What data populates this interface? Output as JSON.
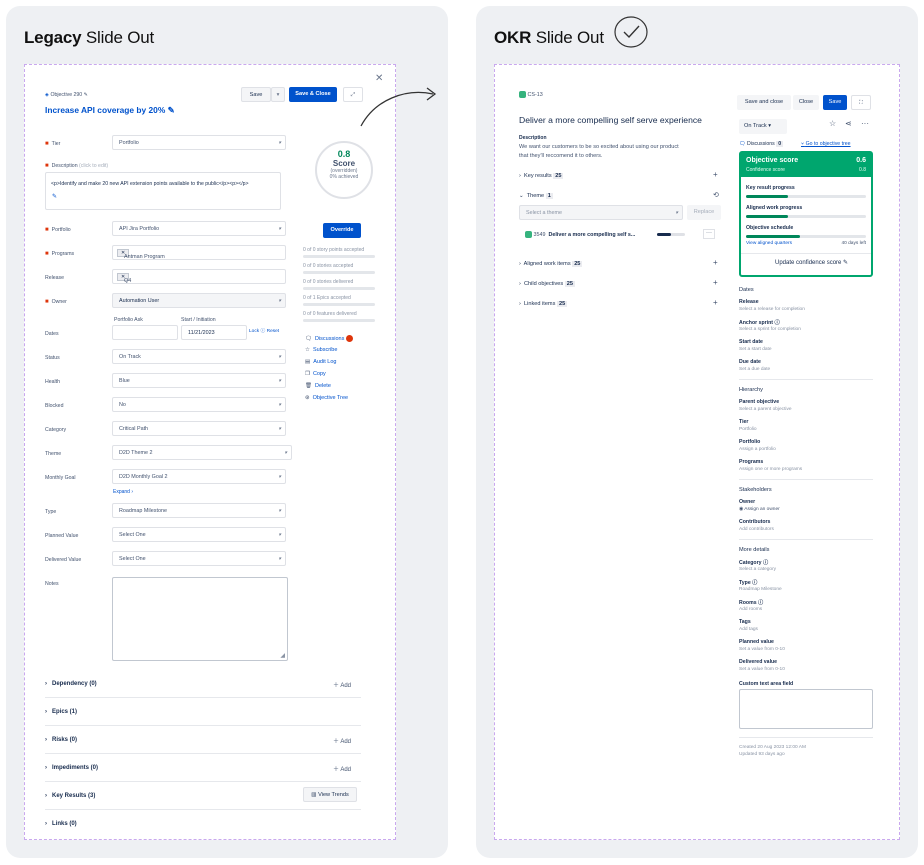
{
  "legacy": {
    "title_bold": "Legacy",
    "title_rest": " Slide Out",
    "objective_id": "Objective 290",
    "objective_title": "Increase API coverage by 20%",
    "save_label": "Save",
    "save_close_label": "Save & Close",
    "score_value": "0.8",
    "score_label": "Score",
    "score_note": "(overridden)",
    "score_achieved": "0% achieved",
    "override_label": "Override",
    "fields": {
      "tier_label": "Tier",
      "tier_value": "Portfolio",
      "description_label": "Description",
      "description_hint": "(click to edit)",
      "description_value": "<p>Identify and make 20 new API extension points available to the public</p><p></p>",
      "portfolio_label": "Portfolio",
      "portfolio_value": "API Jira Portfolio",
      "programs_label": "Programs",
      "programs_tag": "Antman Program",
      "release_label": "Release",
      "release_tag": "Q4",
      "owner_label": "Owner",
      "owner_value": "Automation User",
      "dates_label": "Dates",
      "portfolio_ask_label": "Portfolio Ask",
      "start_label": "Start / Initiation",
      "start_value": "11/21/2023",
      "lock_label": "Lock",
      "reset_label": "Reset",
      "status_label": "Status",
      "status_value": "On Track",
      "health_label": "Health",
      "health_value": "Blue",
      "blocked_label": "Blocked",
      "blocked_value": "No",
      "category_label": "Category",
      "category_value": "Critical Path",
      "theme_label": "Theme",
      "theme_value": "D2D Theme 2",
      "goal_label": "Monthly Goal",
      "goal_value": "D2D Monthly Goal 2",
      "expand_label": "Expand",
      "type_label": "Type",
      "type_value": "Roadmap Milestone",
      "planned_label": "Planned Value",
      "planned_value": "Select One",
      "delivered_label": "Delivered Value",
      "delivered_value": "Select One",
      "notes_label": "Notes"
    },
    "progress": [
      "0 of 0 story points accepted",
      "0 of 0 stories accepted",
      "0 of 0 stories delivered",
      "0 of 1 Epics accepted",
      "0 of 0 features delivered"
    ],
    "actions": {
      "discussions": "Discussions",
      "subscribe": "Subscribe",
      "audit": "Audit Log",
      "copy": "Copy",
      "delete": "Delete",
      "tree": "Objective Tree"
    },
    "sections": {
      "dependency": "Dependency (0)",
      "epics": "Epics (1)",
      "risks": "Risks (0)",
      "impediments": "Impediments (0)",
      "key_results": "Key Results (3)",
      "links": "Links (0)",
      "add": "Add",
      "view_trends": "View Trends"
    }
  },
  "okr": {
    "title_bold": "OKR",
    "title_rest": " Slide Out",
    "id": "CS-13",
    "title": "Deliver a more compelling self serve experience",
    "description_label": "Description",
    "description_text_1": "We want our customers to be so excited about using our product",
    "description_text_2": "that they'll reccomend it to others.",
    "key_results_label": "Key results",
    "key_results_count": "25",
    "theme_label": "Theme",
    "theme_count": "1",
    "select_theme": "Select a theme",
    "replace_label": "Replace",
    "theme_item_id": "3549",
    "theme_item_title": "Deliver a more compelling self s...",
    "aligned_label": "Aligned work items",
    "aligned_count": "25",
    "child_label": "Child objectives",
    "child_count": "25",
    "linked_label": "Linked items",
    "linked_count": "25",
    "save_close_label": "Save and close",
    "close_label": "Close",
    "save_label": "Save",
    "status_value": "On Track",
    "discussions_label": "Discussions",
    "discussions_count": "0",
    "tree_label": "Go to objective tree",
    "score_title": "Objective score",
    "score_value": "0.6",
    "confidence_label": "Confidence score",
    "confidence_value": "0.8",
    "kr_progress": "Key result progress",
    "aligned_progress": "Aligned work progress",
    "schedule_label": "Objective schedule",
    "view_quarters": "View aligned quarters",
    "days_left": "40 days left",
    "update_confidence": "Update confidence score",
    "dates_head": "Dates",
    "release_label": "Release",
    "release_hint": "Select a release for completion",
    "anchor_label": "Anchor sprint",
    "anchor_hint": "Select a sprint for completion",
    "start_label": "Start date",
    "start_hint": "Set a start date",
    "due_label": "Due date",
    "due_hint": "Set a due date",
    "hierarchy_head": "Hierarchy",
    "parent_label": "Parent objective",
    "parent_hint": "Select a parent objective",
    "tier_label": "Tier",
    "tier_value": "Portfolio",
    "portfolio_label": "Portfolio",
    "portfolio_hint": "Assign a portfolio",
    "programs_label": "Programs",
    "programs_hint": "Assign one or more programs",
    "stakeholders_head": "Stakeholders",
    "owner_label": "Owner",
    "owner_hint": "Assign an owner",
    "contributors_label": "Contributors",
    "contributors_hint": "Add contributors",
    "more_head": "More details",
    "category_label": "Category",
    "category_hint": "Select a category",
    "type_label": "Type",
    "type_value": "Roadmap Milestone",
    "rooms_label": "Rooms",
    "rooms_hint": "Add rooms",
    "tags_label": "Tags",
    "tags_hint": "Add tags",
    "planned_label": "Planned value",
    "planned_hint": "Set a value from 0-10",
    "delivered_label": "Delivered value",
    "delivered_hint": "Set a value from 0-10",
    "custom_label": "Custom text area field",
    "created": "Created 20 Aug 2023 12:00 AM",
    "updated": "Updated 93 days ago"
  }
}
